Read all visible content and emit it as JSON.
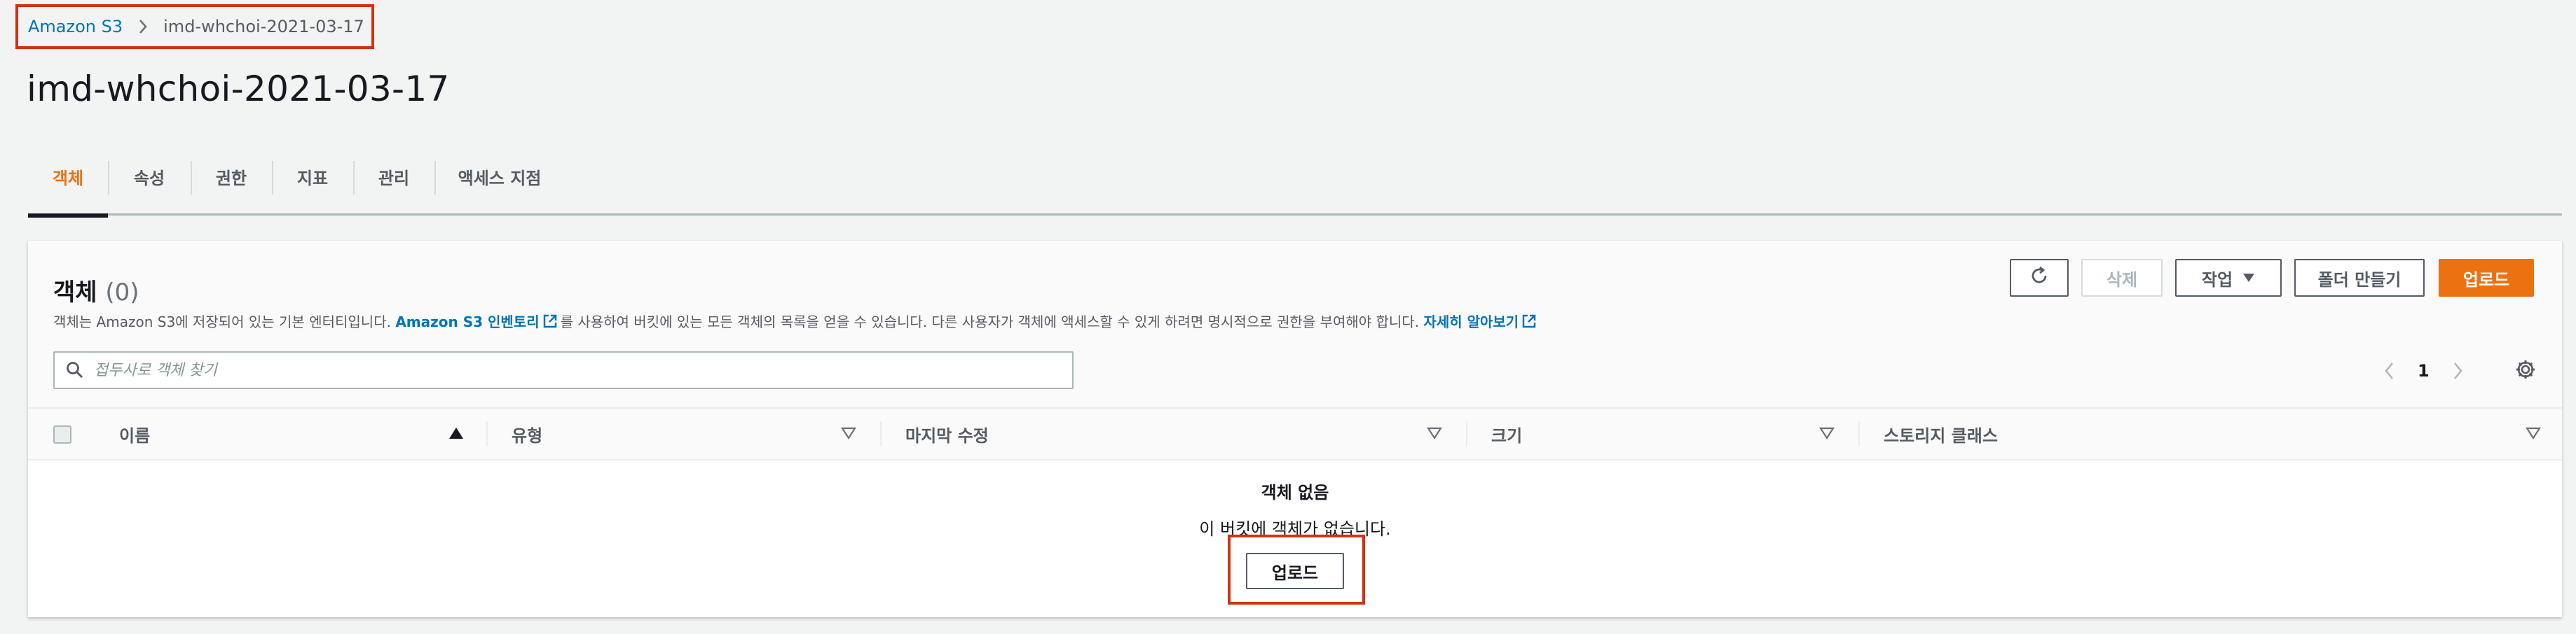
{
  "breadcrumb": {
    "root": "Amazon S3",
    "current": "imd-whchoi-2021-03-17"
  },
  "page_title": "imd-whchoi-2021-03-17",
  "tabs": [
    {
      "label": "객체",
      "active": true
    },
    {
      "label": "속성",
      "active": false
    },
    {
      "label": "권한",
      "active": false
    },
    {
      "label": "지표",
      "active": false
    },
    {
      "label": "관리",
      "active": false
    },
    {
      "label": "액세스 지점",
      "active": false
    }
  ],
  "objects": {
    "title": "객체",
    "count": "(0)",
    "description": {
      "part1": "객체는 Amazon S3에 저장되어 있는 기본 엔터티입니다. ",
      "link1": "Amazon S3 인벤토리",
      "part2": "를 사용하여 버킷에 있는 모든 객체의 목록을 얻을 수 있습니다. 다른 사용자가 객체에 액세스할 수 있게 하려면 명시적으로 권한을 부여해야 합니다. ",
      "link2": "자세히 알아보기"
    },
    "actions": {
      "delete": "삭제",
      "actions": "작업",
      "create_folder": "폴더 만들기",
      "upload": "업로드"
    },
    "search_placeholder": "접두사로 객체 찾기",
    "pagination": {
      "current_page": "1"
    },
    "columns": [
      "이름",
      "유형",
      "마지막 수정",
      "크기",
      "스토리지 클래스"
    ],
    "empty": {
      "title": "객체 없음",
      "message": "이 버킷에 객체가 없습니다.",
      "upload_button": "업로드"
    }
  },
  "colors": {
    "accent": "#ec7211",
    "link": "#0073bb",
    "highlight": "#d13212"
  },
  "icons": [
    "chevron-right-icon",
    "refresh-icon",
    "caret-down-icon",
    "search-icon",
    "chevron-left-icon",
    "gear-icon",
    "sort-ascending-icon",
    "sort-icon",
    "external-link-icon"
  ]
}
